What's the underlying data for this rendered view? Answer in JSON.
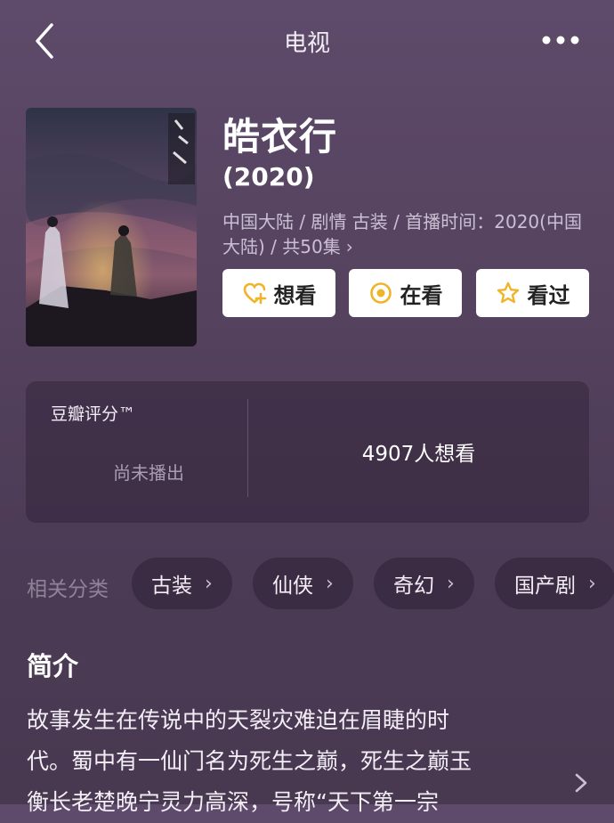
{
  "header": {
    "title": "电视"
  },
  "movie": {
    "title": "皓衣行",
    "year": "(2020)",
    "meta": "中国大陆 / 剧情 古装 / 首播时间：2020(中国大陆) / 共50集",
    "meta_chevron": "›"
  },
  "actions": [
    {
      "label": "想看",
      "icon": "heart-plus-icon"
    },
    {
      "label": "在看",
      "icon": "circle-dot-icon"
    },
    {
      "label": "看过",
      "icon": "star-icon"
    }
  ],
  "rating": {
    "title": "豆瓣评分™",
    "status": "尚未播出",
    "want_count": "4907人想看"
  },
  "categories": {
    "label": "相关分类",
    "items": [
      "古装",
      "仙侠",
      "奇幻",
      "国产剧"
    ],
    "chevron": "›"
  },
  "synopsis": {
    "title": "简介",
    "lines": [
      "故事发生在传说中的天裂灾难迫在眉睫的时",
      "代。蜀中有一仙门名为死生之巅，死生之巅玉",
      "衡长老楚晚宁灵力高深，号称“天下第一宗"
    ]
  },
  "colors": {
    "accent_yellow": "#f0b429",
    "background": "#55435f"
  }
}
